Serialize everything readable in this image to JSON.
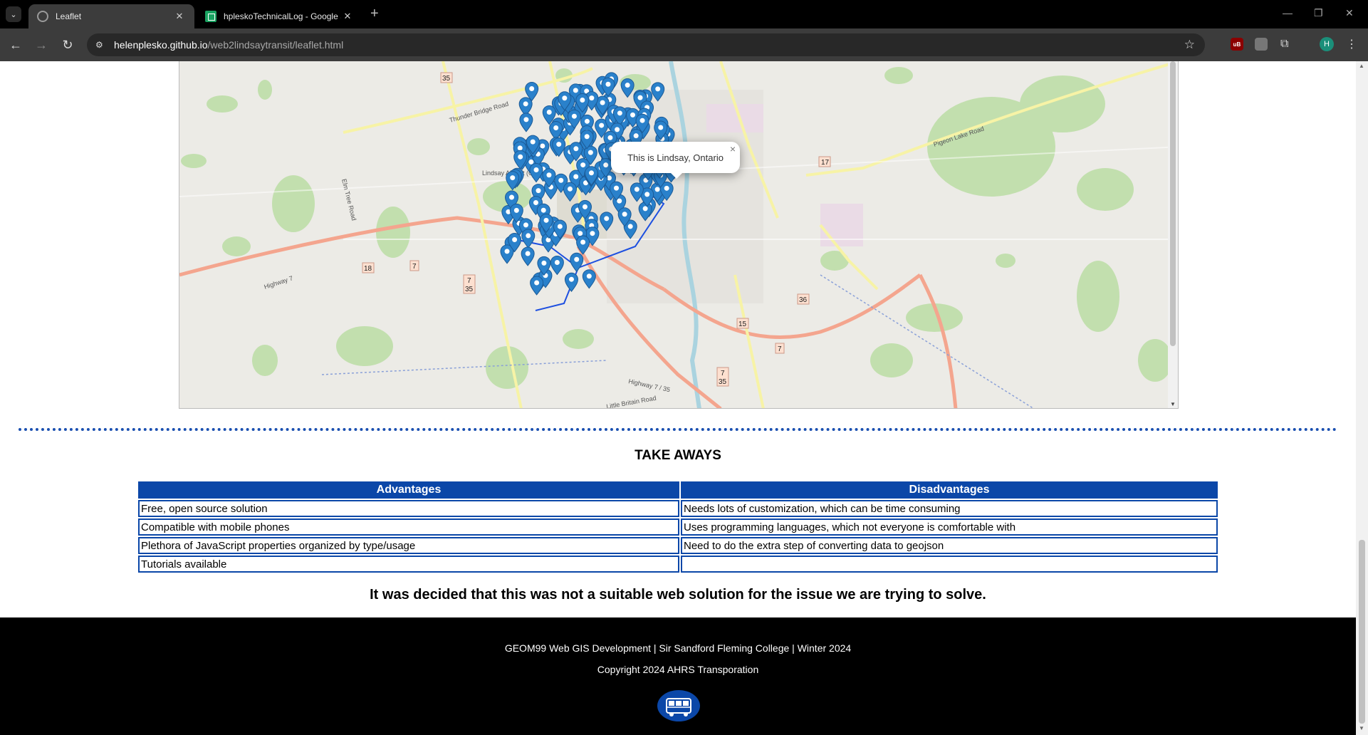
{
  "browser": {
    "tabs": [
      {
        "title": "Leaflet",
        "active": true
      },
      {
        "title": "hpleskoTechnicalLog - Google S",
        "active": false
      }
    ],
    "url_domain": "helenplesko.github.io",
    "url_path": "/web2lindsaytransit/leaflet.html",
    "profile_initial": "H",
    "extension_badge": "uB"
  },
  "map": {
    "popup_text": "This is Lindsay, Ontario",
    "popup_close": "×",
    "road_labels": [
      "Thunder Bridge Road",
      "Elm Tree Road",
      "Highway 7",
      "Pigeon Lake Road",
      "Highway 7 / 35",
      "Little Britain Road",
      "Lindsay Airport (CNF4)"
    ],
    "route_shields": [
      "35",
      "18",
      "7",
      "17",
      "36",
      "15"
    ]
  },
  "takeaways": {
    "heading": "TAKE AWAYS",
    "columns": [
      "Advantages",
      "Disadvantages"
    ],
    "rows": [
      [
        "Free, open source solution",
        "Needs lots of customization, which can be time consuming"
      ],
      [
        "Compatible with mobile phones",
        "Uses programming languages, which not everyone is comfortable with"
      ],
      [
        "Plethora of JavaScript properties organized by type/usage",
        "Need to do the extra step of converting data to geojson"
      ],
      [
        "Tutorials available",
        ""
      ]
    ],
    "conclusion": "It was decided that this was not a suitable web solution for the issue we are trying to solve."
  },
  "footer": {
    "line1": "GEOM99 Web GIS Development | Sir Sandford Fleming College | Winter 2024",
    "line2": "Copyright 2024 AHRS Transporation",
    "logo_icon": "bus-icon"
  },
  "colors": {
    "table_header": "#0b47a8",
    "marker": "#2a81cb",
    "footer_bg": "#000000"
  }
}
